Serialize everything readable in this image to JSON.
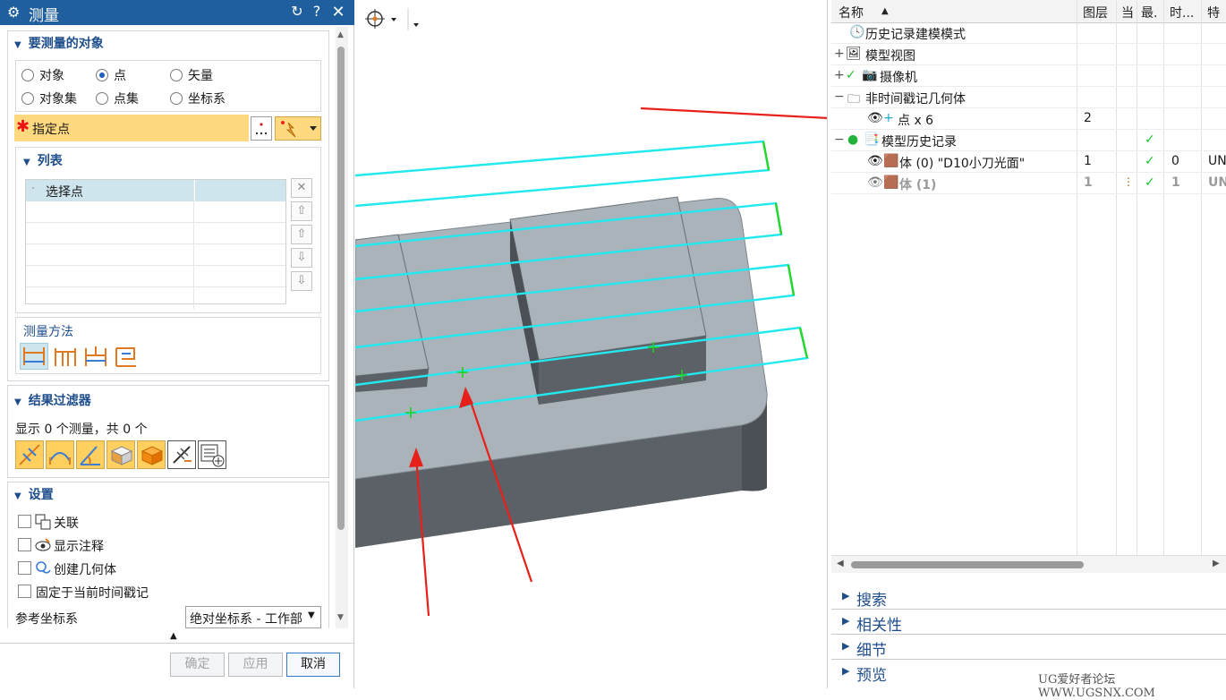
{
  "dialog": {
    "title": "测量",
    "title_buttons": [
      "reset-icon",
      "help-icon",
      "close-icon"
    ],
    "object_group": {
      "title": "要测量的对象",
      "options": [
        {
          "label": "对象",
          "selected": false
        },
        {
          "label": "点",
          "selected": true
        },
        {
          "label": "矢量",
          "selected": false
        },
        {
          "label": "对象集",
          "selected": false
        },
        {
          "label": "点集",
          "selected": false
        },
        {
          "label": "坐标系",
          "selected": false
        }
      ],
      "specify_point": "指定点"
    },
    "list_group": {
      "title": "列表",
      "rows": [
        "选择点",
        "",
        "",
        "",
        "",
        ""
      ]
    },
    "method": {
      "title": "测量方法"
    },
    "filter": {
      "title": "结果过滤器",
      "status": "显示 0 个测量，共 0 个"
    },
    "settings": {
      "title": "设置",
      "items": [
        {
          "label": "关联",
          "checked": false
        },
        {
          "label": "显示注释",
          "checked": false
        },
        {
          "label": "创建几何体",
          "checked": false
        },
        {
          "label": "固定于当前时间戳记",
          "checked": false
        }
      ],
      "ref_csys_label": "参考坐标系",
      "ref_csys_value": "绝对坐标系 - 工作部"
    },
    "buttons": {
      "ok": "确定",
      "apply": "应用",
      "cancel": "取消"
    }
  },
  "navigator": {
    "columns": [
      "名称",
      "图层",
      "当",
      "最.",
      "时...",
      "特"
    ],
    "rows": [
      {
        "name": "历史记录建模模式",
        "layer": "",
        "col3": "",
        "latest": "",
        "time": "",
        "feat": ""
      },
      {
        "name": "模型视图",
        "layer": "",
        "col3": "",
        "latest": "",
        "time": "",
        "feat": ""
      },
      {
        "name": "摄像机",
        "layer": "",
        "col3": "",
        "latest": "",
        "time": "",
        "feat": ""
      },
      {
        "name": "非时间戳记几何体",
        "layer": "",
        "col3": "",
        "latest": "",
        "time": "",
        "feat": ""
      },
      {
        "name": "点 x 6",
        "layer": "2",
        "col3": "",
        "latest": "",
        "time": "",
        "feat": ""
      },
      {
        "name": "模型历史记录",
        "layer": "",
        "col3": "",
        "latest": "✓",
        "time": "",
        "feat": ""
      },
      {
        "name": "体 (0) \"D10小刀光面\"",
        "layer": "1",
        "col3": "",
        "latest": "✓",
        "time": "0",
        "feat": "UN"
      },
      {
        "name": "体 (1)",
        "layer": "1",
        "col3": "",
        "latest": "✓",
        "time": "1",
        "feat": "UN"
      }
    ],
    "panels": [
      "搜索",
      "相关性",
      "细节",
      "预览"
    ]
  },
  "watermark": "UG爱好者论坛 WWW.UGSNX.COM",
  "colors": {
    "titlebar": "#1f5f9e",
    "highlight": "#ffd980",
    "wire": "#22e8f0",
    "arrow": "#e8201a",
    "part_top": "#a9b3b9",
    "part_side": "#5b6166"
  }
}
